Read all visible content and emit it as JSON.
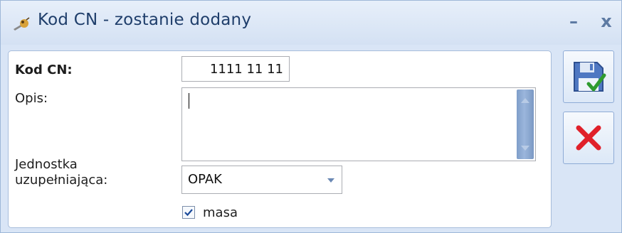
{
  "window": {
    "title": "Kod CN - zostanie dodany",
    "minimize_label": "–",
    "close_label": "x"
  },
  "form": {
    "kod_label": "Kod CN:",
    "kod_value": "1111 11 11",
    "opis_label": "Opis:",
    "opis_value": "",
    "jednostka_label_line1": "Jednostka",
    "jednostka_label_line2": "uzupełniająca:",
    "jednostka_value": "OPAK",
    "masa_label": "masa",
    "masa_checked": true
  },
  "actions": {
    "save_icon": "floppy-disk-check-icon",
    "cancel_icon": "red-x-icon"
  },
  "colors": {
    "window_bg": "#d9e5f6",
    "title_text": "#1f3e6b",
    "accent_blue": "#6a88b4",
    "cancel_red": "#e0202a",
    "check_green": "#2f9b2f"
  }
}
